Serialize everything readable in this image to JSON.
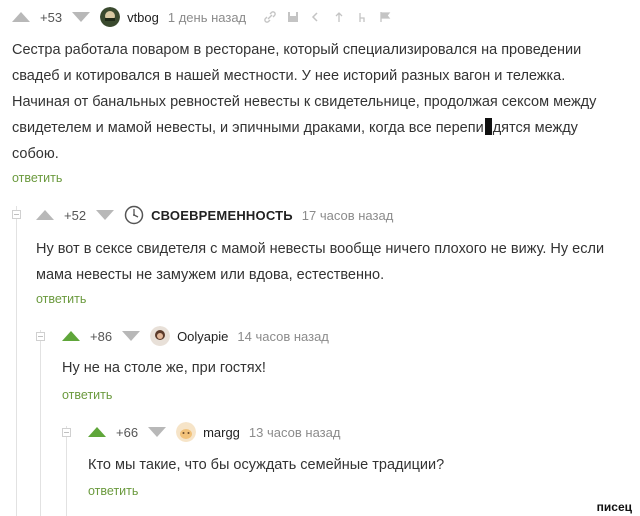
{
  "comments": [
    {
      "rating": "+53",
      "author": "vtbog",
      "time": "1 день назад",
      "text_lines": [
        "Сестра работала поваром в ресторане, который специализировался на проведении",
        "свадеб и котировался в нашей местности. У нее историй разных вагон и тележка.",
        "Начиная от банальных ревностей невесты к свидетельнице, продолжая сексом между",
        "свидетелем и мамой невесты, и эпичными драками, когда все перепи"
      ],
      "text_line4_tail": "дятся между",
      "text_line5": "собою.",
      "reply": "ответить"
    },
    {
      "rating": "+52",
      "author": "СВОЕВРЕМЕННОСТЬ",
      "time": "17 часов назад",
      "text_lines": [
        "Ну вот в сексе свидетеля с мамой невесты вообще ничего плохого не вижу. Ну если",
        "мама невесты не замужем или вдова, естественно."
      ],
      "reply": "ответить"
    },
    {
      "rating": "+86",
      "author": "Oolyapie",
      "time": "14 часов назад",
      "text_lines": [
        "Ну не на столе же, при гостях!"
      ],
      "reply": "ответить"
    },
    {
      "rating": "+66",
      "author": "margg",
      "time": "13 часов назад",
      "text_lines": [
        "Кто мы такие, что бы осуждать семейные традиции?"
      ],
      "reply": "ответить"
    }
  ],
  "tools": [
    "link-icon",
    "save-icon",
    "back-icon",
    "up-icon",
    "text-icon",
    "flag-icon"
  ],
  "watermark": "писец",
  "colors": {
    "reply_green": "#6b9a3e",
    "vote_green": "#5fa63a",
    "line": "#e2e2e2"
  }
}
